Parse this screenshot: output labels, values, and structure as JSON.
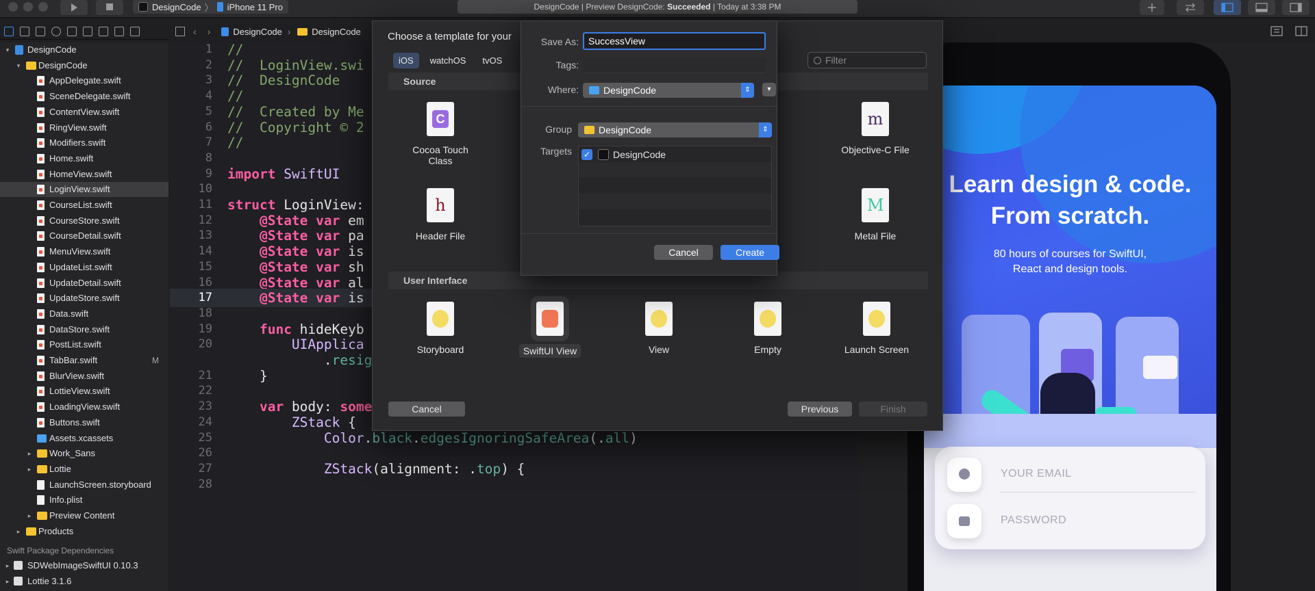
{
  "toolbar": {
    "scheme_app": "DesignCode",
    "scheme_device": "iPhone 11 Pro",
    "status_prefix": "DesignCode | Preview DesignCode: ",
    "status_result": "Succeeded",
    "status_time": " | Today at 3:38 PM"
  },
  "navigator": {
    "items": [
      {
        "label": "DesignCode",
        "kind": "project",
        "depth": 0,
        "disclosure": "▾"
      },
      {
        "label": "DesignCode",
        "kind": "folder",
        "depth": 1,
        "disclosure": "▾"
      },
      {
        "label": "AppDelegate.swift",
        "kind": "swift",
        "depth": 2
      },
      {
        "label": "SceneDelegate.swift",
        "kind": "swift",
        "depth": 2
      },
      {
        "label": "ContentView.swift",
        "kind": "swift",
        "depth": 2
      },
      {
        "label": "RingView.swift",
        "kind": "swift",
        "depth": 2
      },
      {
        "label": "Modifiers.swift",
        "kind": "swift",
        "depth": 2
      },
      {
        "label": "Home.swift",
        "kind": "swift",
        "depth": 2
      },
      {
        "label": "HomeView.swift",
        "kind": "swift",
        "depth": 2
      },
      {
        "label": "LoginView.swift",
        "kind": "swift",
        "depth": 2,
        "selected": true
      },
      {
        "label": "CourseList.swift",
        "kind": "swift",
        "depth": 2
      },
      {
        "label": "CourseStore.swift",
        "kind": "swift",
        "depth": 2
      },
      {
        "label": "CourseDetail.swift",
        "kind": "swift",
        "depth": 2
      },
      {
        "label": "MenuView.swift",
        "kind": "swift",
        "depth": 2
      },
      {
        "label": "UpdateList.swift",
        "kind": "swift",
        "depth": 2
      },
      {
        "label": "UpdateDetail.swift",
        "kind": "swift",
        "depth": 2
      },
      {
        "label": "UpdateStore.swift",
        "kind": "swift",
        "depth": 2
      },
      {
        "label": "Data.swift",
        "kind": "swift",
        "depth": 2
      },
      {
        "label": "DataStore.swift",
        "kind": "swift",
        "depth": 2
      },
      {
        "label": "PostList.swift",
        "kind": "swift",
        "depth": 2
      },
      {
        "label": "TabBar.swift",
        "kind": "swift",
        "depth": 2,
        "badge": "M"
      },
      {
        "label": "BlurView.swift",
        "kind": "swift",
        "depth": 2
      },
      {
        "label": "LottieView.swift",
        "kind": "swift",
        "depth": 2
      },
      {
        "label": "LoadingView.swift",
        "kind": "swift",
        "depth": 2
      },
      {
        "label": "Buttons.swift",
        "kind": "swift",
        "depth": 2
      },
      {
        "label": "Assets.xcassets",
        "kind": "assets",
        "depth": 2
      },
      {
        "label": "Work_Sans",
        "kind": "folder",
        "depth": 2,
        "disclosure": "▸"
      },
      {
        "label": "Lottie",
        "kind": "folder",
        "depth": 2,
        "disclosure": "▸"
      },
      {
        "label": "LaunchScreen.storyboard",
        "kind": "plain",
        "depth": 2
      },
      {
        "label": "Info.plist",
        "kind": "plain",
        "depth": 2
      },
      {
        "label": "Preview Content",
        "kind": "folder",
        "depth": 2,
        "disclosure": "▸"
      },
      {
        "label": "Products",
        "kind": "folder",
        "depth": 1,
        "disclosure": "▸"
      }
    ],
    "packages_header": "Swift Package Dependencies",
    "packages": [
      {
        "label": "SDWebImageSwiftUI 0.10.3"
      },
      {
        "label": "Lottie 3.1.6"
      }
    ]
  },
  "jumpbar": {
    "project": "DesignCode",
    "folder": "DesignCode"
  },
  "editor": {
    "current_line": "17",
    "lines": [
      {
        "n": "1",
        "text": "//"
      },
      {
        "n": "2",
        "text": "//  LoginView.swi"
      },
      {
        "n": "3",
        "text": "//  DesignCode"
      },
      {
        "n": "4",
        "text": "//"
      },
      {
        "n": "5",
        "text": "//  Created by Me"
      },
      {
        "n": "6",
        "text": "//  Copyright © 2"
      },
      {
        "n": "7",
        "text": "//"
      },
      {
        "n": "8",
        "text": ""
      },
      {
        "n": "9",
        "text": "import SwiftUI"
      },
      {
        "n": "10",
        "text": ""
      },
      {
        "n": "11",
        "text": "struct LoginView:"
      },
      {
        "n": "12",
        "text": "    @State var em"
      },
      {
        "n": "13",
        "text": "    @State var pa"
      },
      {
        "n": "14",
        "text": "    @State var is"
      },
      {
        "n": "15",
        "text": "    @State var sh"
      },
      {
        "n": "16",
        "text": "    @State var al"
      },
      {
        "n": "17",
        "text": "    @State var is"
      },
      {
        "n": "18",
        "text": ""
      },
      {
        "n": "19",
        "text": "    func hideKeyb"
      },
      {
        "n": "20",
        "text": "        UIApplica"
      },
      {
        "n": "",
        "text": "            .resignFirstResponder), to: nil, from: nil, for: nil)"
      },
      {
        "n": "21",
        "text": "    }"
      },
      {
        "n": "22",
        "text": ""
      },
      {
        "n": "23",
        "text": "    var body: some View {"
      },
      {
        "n": "24",
        "text": "        ZStack {"
      },
      {
        "n": "25",
        "text": "            Color.black.edgesIgnoringSafeArea(.all)"
      },
      {
        "n": "26",
        "text": ""
      },
      {
        "n": "27",
        "text": "            ZStack(alignment: .top) {"
      },
      {
        "n": "28",
        "text": ""
      }
    ]
  },
  "template_sheet": {
    "title": "Choose a template for your",
    "platforms": [
      "iOS",
      "watchOS",
      "tvOS"
    ],
    "active_platform": "iOS",
    "filter_placeholder": "Filter",
    "sections": [
      "Source",
      "User Interface"
    ],
    "source_templates": [
      {
        "name": "Cocoa Touch Class",
        "glyph": "C",
        "color": "#9a6be0"
      },
      {
        "name": "Objective-C File",
        "glyph": "m",
        "color": "#4a2a6a"
      },
      {
        "name": "Header File",
        "glyph": "h",
        "color": "#8a1a2a"
      },
      {
        "name": "Metal File",
        "glyph": "M",
        "color": "#3cc8a0"
      }
    ],
    "ui_templates": [
      {
        "name": "Storyboard",
        "color": "#f2d64a"
      },
      {
        "name": "SwiftUI View",
        "color": "#f0603a",
        "selected": true
      },
      {
        "name": "View",
        "color": "#f2d64a"
      },
      {
        "name": "Empty",
        "color": "#f2d64a"
      },
      {
        "name": "Launch Screen",
        "color": "#f2d64a"
      }
    ],
    "cancel": "Cancel",
    "previous": "Previous",
    "finish": "Finish"
  },
  "save_dialog": {
    "save_as_label": "Save As:",
    "save_as_value": "SuccessView",
    "tags_label": "Tags:",
    "where_label": "Where:",
    "where_value": "DesignCode",
    "group_label": "Group",
    "group_value": "DesignCode",
    "targets_label": "Targets",
    "target_name": "DesignCode",
    "target_checked": true,
    "cancel": "Cancel",
    "create": "Create"
  },
  "preview": {
    "title_line1": "Learn design & code.",
    "title_line2": "From scratch.",
    "subtitle_line1": "80 hours of courses for SwiftUI,",
    "subtitle_line2": "React and design tools.",
    "email_placeholder": "YOUR EMAIL",
    "password_placeholder": "PASSWORD"
  },
  "colors": {
    "accent": "#3d7ee6",
    "hero": "#4262f0",
    "folder": "#f4c430",
    "swift_keyword": "#fc5fa3",
    "comment": "#84a86a"
  }
}
